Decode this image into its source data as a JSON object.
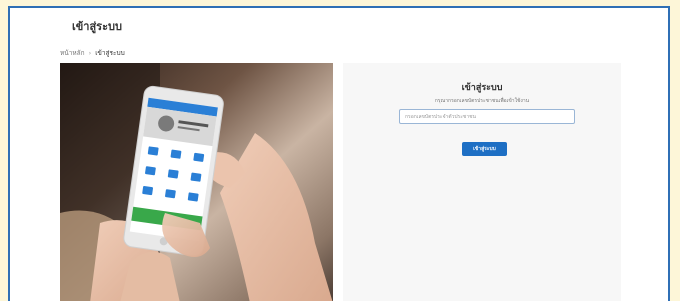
{
  "header": {
    "title": "เข้าสู่ระบบ"
  },
  "breadcrumb": {
    "home": "หน้าหลัก",
    "separator": "›",
    "current": "เข้าสู่ระบบ"
  },
  "hero": {
    "image": "hand-holding-smartphone-photo"
  },
  "login": {
    "title": "เข้าสู่ระบบ",
    "subtitle": "กรุณากรอกเลขบัตรประชาชนเพื่อเข้าใช้งาน",
    "input_placeholder": "กรอกเลขบัตรประจำตัวประชาชน",
    "submit_label": "เข้าสู่ระบบ"
  },
  "colors": {
    "accent": "#1e6fc4",
    "frame_border": "#2f6fb5",
    "outer_background": "#fdf6d8"
  }
}
